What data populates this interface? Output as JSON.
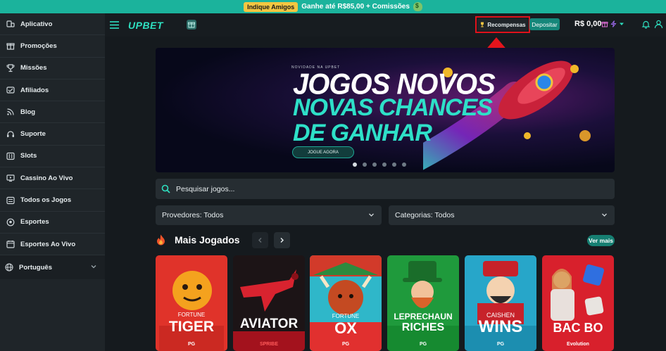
{
  "promo": {
    "badge": "Indique Amigos",
    "text": "Ganhe até R$85,00 + Comissões",
    "icon": "money-bag-icon"
  },
  "sidebar": {
    "items": [
      {
        "label": "Aplicativo",
        "icon": "phone-icon"
      },
      {
        "label": "Promoções",
        "icon": "gift-icon"
      },
      {
        "label": "Missões",
        "icon": "trophy-icon"
      },
      {
        "label": "Afiliados",
        "icon": "handshake-icon"
      },
      {
        "label": "Blog",
        "icon": "rss-icon"
      },
      {
        "label": "Suporte",
        "icon": "headset-icon"
      },
      {
        "label": "Slots",
        "icon": "slot-machine-icon"
      },
      {
        "label": "Cassino Ao Vivo",
        "icon": "live-tv-icon"
      },
      {
        "label": "Todos os Jogos",
        "icon": "list-icon"
      },
      {
        "label": "Esportes",
        "icon": "ball-icon"
      },
      {
        "label": "Esportes Ao Vivo",
        "icon": "calendar-icon"
      }
    ],
    "language": "Português"
  },
  "header": {
    "logo": "UPBET",
    "rewards_label": "Recompensas",
    "deposit_label": "Depositar",
    "balance": "R$ 0,00"
  },
  "banner": {
    "tagline": "NOVIDADE NA UPBET",
    "line1": "JOGOS NOVOS",
    "line2": "NOVAS CHANCES",
    "line3": "DE GANHAR",
    "cta": "JOGUE AGORA"
  },
  "search": {
    "placeholder": "Pesquisar jogos..."
  },
  "filters": {
    "providers": "Provedores: Todos",
    "categories": "Categorias: Todos"
  },
  "section": {
    "title": "Mais Jogados",
    "see_more": "Ver mais"
  },
  "games": [
    {
      "line1": "FORTUNE",
      "line2": "TIGER",
      "provider": "PG",
      "color": "#e0332a"
    },
    {
      "line1": "AVIATOR",
      "line2": "",
      "provider": "SPRIBE",
      "color": "#a3121d"
    },
    {
      "line1": "FORTUNE",
      "line2": "OX",
      "provider": "PG",
      "color": "#e1302f"
    },
    {
      "line1": "LEPRECHAUN",
      "line2": "RICHES",
      "provider": "PG",
      "color": "#1f9a3c"
    },
    {
      "line1": "CAISHEN",
      "line2": "WINS",
      "provider": "PG",
      "color": "#27a6c9"
    },
    {
      "line1": "BAC BO",
      "line2": "",
      "provider": "Evolution",
      "color": "#d8202c"
    }
  ],
  "colors": {
    "accent": "#1bb39c",
    "highlight": "#e0121b",
    "background": "#151a1e"
  }
}
